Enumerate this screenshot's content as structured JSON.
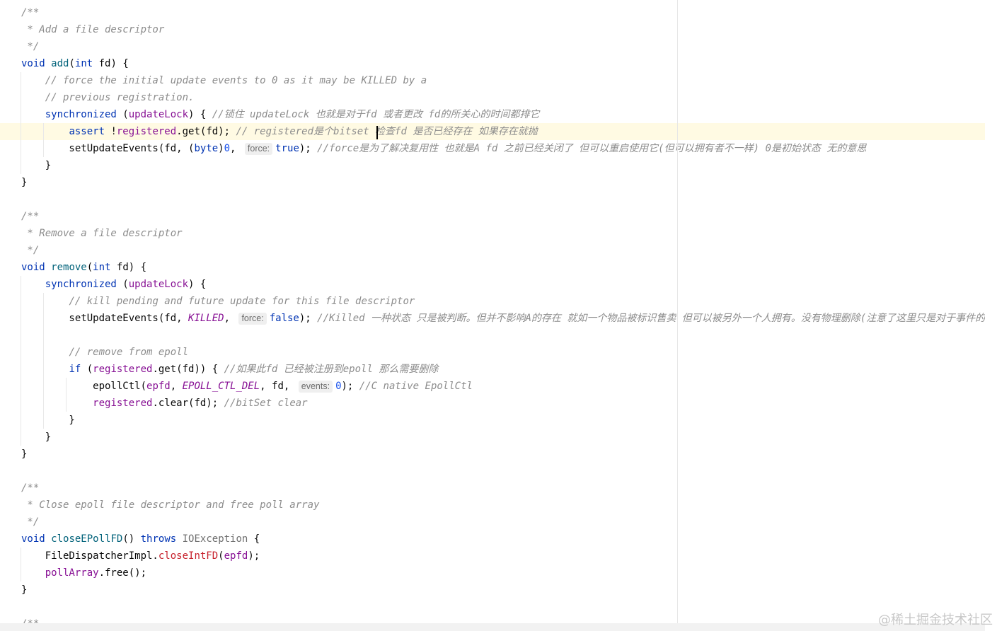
{
  "editor": {
    "lines": [
      {
        "tokens": [
          {
            "t": "/**",
            "c": "doc"
          }
        ]
      },
      {
        "tokens": [
          {
            "t": " * Add a file descriptor",
            "c": "doc"
          }
        ]
      },
      {
        "tokens": [
          {
            "t": " */",
            "c": "doc"
          }
        ]
      },
      {
        "tokens": [
          {
            "t": "void",
            "c": "kw"
          },
          {
            "t": " "
          },
          {
            "t": "add",
            "c": "fn"
          },
          {
            "t": "("
          },
          {
            "t": "int",
            "c": "kw"
          },
          {
            "t": " fd) {"
          }
        ]
      },
      {
        "tokens": [
          {
            "t": "    "
          },
          {
            "t": "// force the initial update events to 0 as it may be KILLED by a",
            "c": "cmt"
          }
        ]
      },
      {
        "tokens": [
          {
            "t": "    "
          },
          {
            "t": "// previous registration.",
            "c": "cmt"
          }
        ]
      },
      {
        "tokens": [
          {
            "t": "    "
          },
          {
            "t": "synchronized",
            "c": "kw"
          },
          {
            "t": " ("
          },
          {
            "t": "updateLock",
            "c": "fld"
          },
          {
            "t": ") { "
          },
          {
            "t": "//锁住 updateLock 也就是对于fd 或者更改 fd的所关心的时间都排它",
            "c": "cmt"
          }
        ]
      },
      {
        "current": true,
        "tokens": [
          {
            "t": "        "
          },
          {
            "t": "assert",
            "c": "kw"
          },
          {
            "t": " !"
          },
          {
            "t": "registered",
            "c": "fld"
          },
          {
            "t": ".get(fd); "
          },
          {
            "t": "// registered是个bitset 检查fd 是否已经存在 如果存在就抛",
            "c": "cmt"
          }
        ]
      },
      {
        "tokens": [
          {
            "t": "        setUpdateEvents(fd, ("
          },
          {
            "t": "byte",
            "c": "kw"
          },
          {
            "t": ")"
          },
          {
            "t": "0",
            "c": "num"
          },
          {
            "t": ", "
          },
          {
            "t": "force:",
            "c": "hint"
          },
          {
            "t": "true",
            "c": "kw"
          },
          {
            "t": "); "
          },
          {
            "t": "//force是为了解决复用性 也就是A fd 之前已经关闭了 但可以重启使用它(但可以拥有者不一样) 0是初始状态 无的意思",
            "c": "cmt"
          }
        ]
      },
      {
        "tokens": [
          {
            "t": "    }"
          }
        ]
      },
      {
        "tokens": [
          {
            "t": "}"
          }
        ]
      },
      {
        "tokens": []
      },
      {
        "tokens": [
          {
            "t": "/**",
            "c": "doc"
          }
        ]
      },
      {
        "tokens": [
          {
            "t": " * Remove a file descriptor",
            "c": "doc"
          }
        ]
      },
      {
        "tokens": [
          {
            "t": " */",
            "c": "doc"
          }
        ]
      },
      {
        "tokens": [
          {
            "t": "void",
            "c": "kw"
          },
          {
            "t": " "
          },
          {
            "t": "remove",
            "c": "fn"
          },
          {
            "t": "("
          },
          {
            "t": "int",
            "c": "kw"
          },
          {
            "t": " fd) {"
          }
        ]
      },
      {
        "tokens": [
          {
            "t": "    "
          },
          {
            "t": "synchronized",
            "c": "kw"
          },
          {
            "t": " ("
          },
          {
            "t": "updateLock",
            "c": "fld"
          },
          {
            "t": ") {"
          }
        ]
      },
      {
        "tokens": [
          {
            "t": "        "
          },
          {
            "t": "// kill pending and future update for this file descriptor",
            "c": "cmt"
          }
        ]
      },
      {
        "tokens": [
          {
            "t": "        setUpdateEvents(fd, "
          },
          {
            "t": "KILLED",
            "c": "const"
          },
          {
            "t": ", "
          },
          {
            "t": "force:",
            "c": "hint"
          },
          {
            "t": "false",
            "c": "kw"
          },
          {
            "t": "); "
          },
          {
            "t": "//Killed 一种状态 只是被判断。但并不影响A的存在 就如一个物品被标识售卖 但可以被另外一个人拥有。没有物理删除(注意了这里只是对于事件的更改)",
            "c": "cmt"
          }
        ]
      },
      {
        "tokens": []
      },
      {
        "tokens": [
          {
            "t": "        "
          },
          {
            "t": "// remove from epoll",
            "c": "cmt"
          }
        ]
      },
      {
        "tokens": [
          {
            "t": "        "
          },
          {
            "t": "if",
            "c": "kw"
          },
          {
            "t": " ("
          },
          {
            "t": "registered",
            "c": "fld"
          },
          {
            "t": ".get(fd)) { "
          },
          {
            "t": "//如果此fd 已经被注册到epoll 那么需要删除",
            "c": "cmt"
          }
        ]
      },
      {
        "tokens": [
          {
            "t": "            epollCtl("
          },
          {
            "t": "epfd",
            "c": "fld"
          },
          {
            "t": ", "
          },
          {
            "t": "EPOLL_CTL_DEL",
            "c": "const"
          },
          {
            "t": ", fd, "
          },
          {
            "t": "events:",
            "c": "hint"
          },
          {
            "t": "0",
            "c": "num"
          },
          {
            "t": "); "
          },
          {
            "t": "//C native EpollCtl",
            "c": "cmt"
          }
        ]
      },
      {
        "tokens": [
          {
            "t": "            "
          },
          {
            "t": "registered",
            "c": "fld"
          },
          {
            "t": ".clear(fd); "
          },
          {
            "t": "//bitSet clear",
            "c": "cmt"
          }
        ]
      },
      {
        "tokens": [
          {
            "t": "        }"
          }
        ]
      },
      {
        "tokens": [
          {
            "t": "    }"
          }
        ]
      },
      {
        "tokens": [
          {
            "t": "}"
          }
        ]
      },
      {
        "tokens": []
      },
      {
        "tokens": [
          {
            "t": "/**",
            "c": "doc"
          }
        ]
      },
      {
        "tokens": [
          {
            "t": " * Close epoll file descriptor and free poll array",
            "c": "doc"
          }
        ]
      },
      {
        "tokens": [
          {
            "t": " */",
            "c": "doc"
          }
        ]
      },
      {
        "tokens": [
          {
            "t": "void",
            "c": "kw"
          },
          {
            "t": " "
          },
          {
            "t": "closeEPollFD",
            "c": "fn"
          },
          {
            "t": "() "
          },
          {
            "t": "throws",
            "c": "kw"
          },
          {
            "t": " "
          },
          {
            "t": "IOException",
            "c": "muted"
          },
          {
            "t": " {"
          }
        ]
      },
      {
        "tokens": [
          {
            "t": "    FileDispatcherImpl."
          },
          {
            "t": "closeIntFD",
            "c": "red"
          },
          {
            "t": "("
          },
          {
            "t": "epfd",
            "c": "fld"
          },
          {
            "t": ");"
          }
        ]
      },
      {
        "tokens": [
          {
            "t": "    "
          },
          {
            "t": "pollArray",
            "c": "fld"
          },
          {
            "t": ".free();"
          }
        ]
      },
      {
        "tokens": [
          {
            "t": "}"
          }
        ]
      },
      {
        "tokens": []
      },
      {
        "tokens": [
          {
            "t": "/**",
            "c": "doc"
          }
        ]
      }
    ]
  },
  "colors": {
    "keyword": "#0033b3",
    "field": "#871094",
    "function": "#00627a",
    "number": "#1750eb",
    "comment": "#8c8c8c",
    "current_line": "#fffae3",
    "warning_mark": "#e5c300",
    "error_mark": "#d25252"
  },
  "watermark": "@稀土掘金技术社区"
}
